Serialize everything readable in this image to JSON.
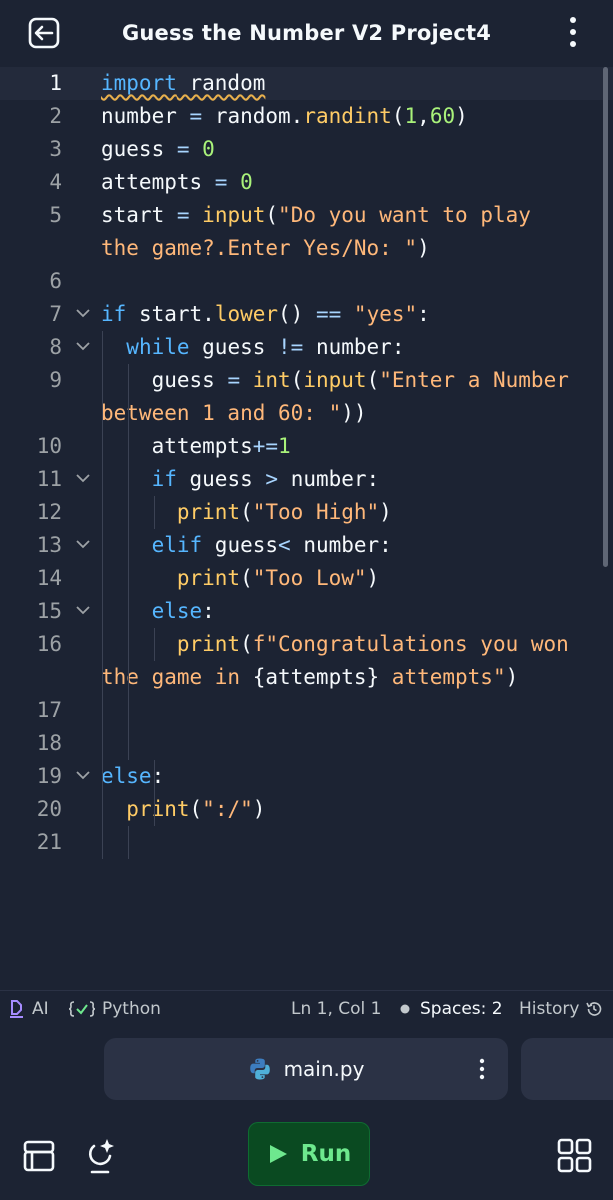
{
  "header": {
    "title": "Guess the Number V2 Project4",
    "back_icon": "exit-icon",
    "menu_icon": "vertical-dots-icon"
  },
  "editor": {
    "active_line": 1,
    "lines": [
      {
        "n": "1",
        "fold": false,
        "tokens": [
          [
            "import",
            "kw squig"
          ],
          [
            " random",
            "squig"
          ]
        ]
      },
      {
        "n": "2",
        "fold": false,
        "tokens": [
          [
            "number ",
            ""
          ],
          [
            "=",
            "op"
          ],
          [
            " random.",
            ""
          ],
          [
            "randint",
            "fn"
          ],
          [
            "(",
            ""
          ],
          [
            "1",
            "num"
          ],
          [
            ",",
            ""
          ],
          [
            "60",
            "num"
          ],
          [
            ")",
            ""
          ]
        ]
      },
      {
        "n": "3",
        "fold": false,
        "tokens": [
          [
            "guess ",
            ""
          ],
          [
            "=",
            "op"
          ],
          [
            " ",
            ""
          ],
          [
            "0",
            "num"
          ]
        ]
      },
      {
        "n": "4",
        "fold": false,
        "tokens": [
          [
            "attempts ",
            ""
          ],
          [
            "=",
            "op"
          ],
          [
            " ",
            ""
          ],
          [
            "0",
            "num"
          ]
        ]
      },
      {
        "n": "5",
        "fold": false,
        "tokens": [
          [
            "start ",
            ""
          ],
          [
            "=",
            "op"
          ],
          [
            " ",
            ""
          ],
          [
            "input",
            "fn"
          ],
          [
            "(",
            ""
          ],
          [
            "\"Do you want to play",
            "str"
          ]
        ]
      },
      {
        "n": "",
        "fold": false,
        "tokens": [
          [
            "the game?.Enter Yes/No: \"",
            "str"
          ],
          [
            ")",
            ""
          ]
        ]
      },
      {
        "n": "6",
        "fold": false,
        "tokens": []
      },
      {
        "n": "7",
        "fold": true,
        "tokens": [
          [
            "if",
            "kw"
          ],
          [
            " start.",
            ""
          ],
          [
            "lower",
            "fn"
          ],
          [
            "() ",
            ""
          ],
          [
            "==",
            "op"
          ],
          [
            " ",
            ""
          ],
          [
            "\"yes\"",
            "str"
          ],
          [
            ":",
            ""
          ]
        ]
      },
      {
        "n": "8",
        "fold": true,
        "tokens": [
          [
            "  ",
            ""
          ],
          [
            "while",
            "kw"
          ],
          [
            " guess ",
            ""
          ],
          [
            "!=",
            "op"
          ],
          [
            " number:",
            ""
          ]
        ]
      },
      {
        "n": "9",
        "fold": false,
        "tokens": [
          [
            "    guess ",
            ""
          ],
          [
            "=",
            "op"
          ],
          [
            " ",
            ""
          ],
          [
            "int",
            "fn"
          ],
          [
            "(",
            ""
          ],
          [
            "input",
            "fn"
          ],
          [
            "(",
            ""
          ],
          [
            "\"Enter a Number",
            "str"
          ]
        ]
      },
      {
        "n": "",
        "fold": false,
        "tokens": [
          [
            "between 1 and 60: \"",
            "str"
          ],
          [
            "))",
            ""
          ]
        ]
      },
      {
        "n": "10",
        "fold": false,
        "tokens": [
          [
            "    attempts",
            ""
          ],
          [
            "+=",
            "op"
          ],
          [
            "1",
            "num"
          ]
        ]
      },
      {
        "n": "11",
        "fold": true,
        "tokens": [
          [
            "    ",
            ""
          ],
          [
            "if",
            "kw"
          ],
          [
            " guess ",
            ""
          ],
          [
            ">",
            "op"
          ],
          [
            " number:",
            ""
          ]
        ]
      },
      {
        "n": "12",
        "fold": false,
        "tokens": [
          [
            "      ",
            ""
          ],
          [
            "print",
            "fn"
          ],
          [
            "(",
            ""
          ],
          [
            "\"Too High\"",
            "str"
          ],
          [
            ")",
            ""
          ]
        ]
      },
      {
        "n": "13",
        "fold": true,
        "tokens": [
          [
            "    ",
            ""
          ],
          [
            "elif",
            "kw"
          ],
          [
            " guess",
            ""
          ],
          [
            "<",
            "op"
          ],
          [
            " number:",
            ""
          ]
        ]
      },
      {
        "n": "14",
        "fold": false,
        "tokens": [
          [
            "      ",
            ""
          ],
          [
            "print",
            "fn"
          ],
          [
            "(",
            ""
          ],
          [
            "\"Too Low\"",
            "str"
          ],
          [
            ")",
            ""
          ]
        ]
      },
      {
        "n": "15",
        "fold": true,
        "tokens": [
          [
            "    ",
            ""
          ],
          [
            "else",
            "kw"
          ],
          [
            ":",
            ""
          ]
        ]
      },
      {
        "n": "16",
        "fold": false,
        "tokens": [
          [
            "      ",
            ""
          ],
          [
            "print",
            "fn"
          ],
          [
            "(",
            ""
          ],
          [
            "f\"Congratulations you won",
            "str"
          ]
        ]
      },
      {
        "n": "",
        "fold": false,
        "tokens": [
          [
            "the game in ",
            "str"
          ],
          [
            "{attempts}",
            ""
          ],
          [
            " attempts\"",
            "str"
          ],
          [
            ")",
            ""
          ]
        ]
      },
      {
        "n": "17",
        "fold": false,
        "tokens": []
      },
      {
        "n": "18",
        "fold": false,
        "tokens": []
      },
      {
        "n": "19",
        "fold": true,
        "tokens": [
          [
            "else",
            "kw"
          ],
          [
            ":",
            ""
          ]
        ]
      },
      {
        "n": "20",
        "fold": false,
        "tokens": [
          [
            "  ",
            ""
          ],
          [
            "print",
            "fn"
          ],
          [
            "(",
            ""
          ],
          [
            "\":/\"",
            "str"
          ],
          [
            ")",
            ""
          ]
        ]
      },
      {
        "n": "21",
        "fold": false,
        "tokens": []
      }
    ]
  },
  "statusbar": {
    "ai_label": "AI",
    "language_label": "Python",
    "position_label": "Ln 1, Col 1",
    "spaces_label": "Spaces: 2",
    "history_label": "History"
  },
  "filebar": {
    "active_file": "main.py"
  },
  "bottombar": {
    "run_label": "Run"
  },
  "colors": {
    "background": "#1c2333",
    "keyword": "#56b6ff",
    "function": "#ffcc66",
    "string": "#ffb87a",
    "number": "#a9f27a",
    "run_button": "#0a4a21",
    "run_text": "#6ee88e"
  }
}
